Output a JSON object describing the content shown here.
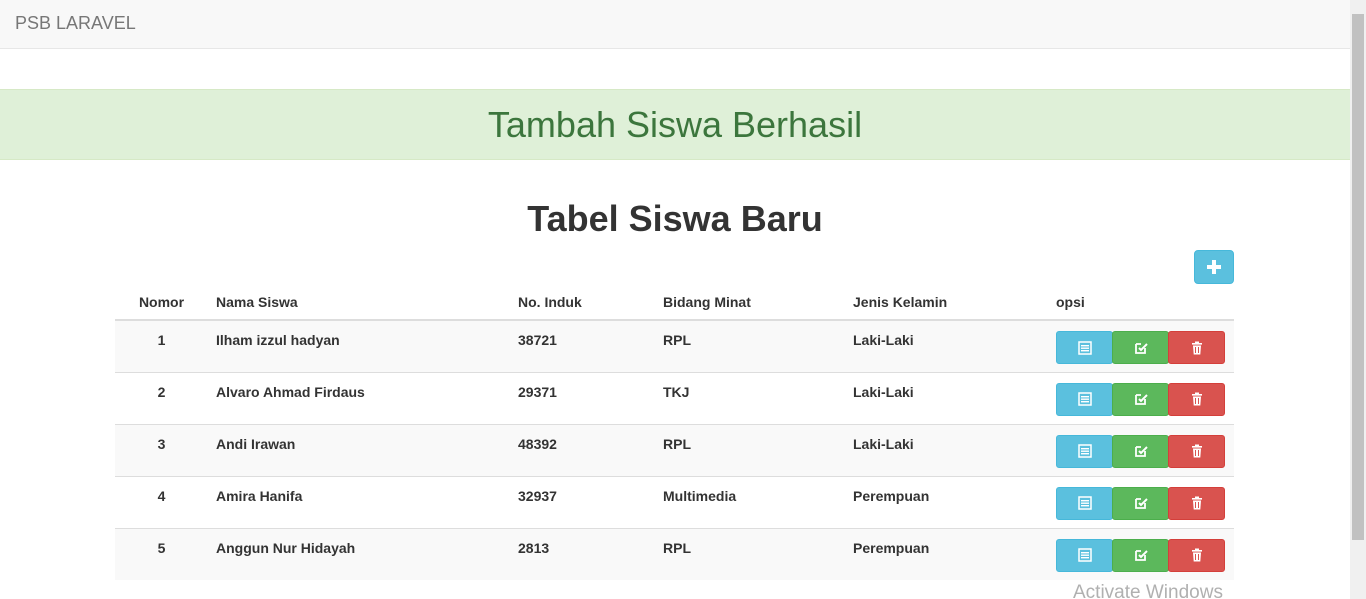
{
  "navbar": {
    "brand": "PSB LARAVEL"
  },
  "alert": {
    "message": "Tambah Siswa Berhasil",
    "color": "#3c763d",
    "background": "#dff0d8"
  },
  "page": {
    "title": "Tabel Siswa Baru"
  },
  "add_button": {
    "icon": "plus-icon"
  },
  "table": {
    "headers": [
      "Nomor",
      "Nama Siswa",
      "No. Induk",
      "Bidang Minat",
      "Jenis Kelamin",
      "opsi"
    ],
    "rows": [
      {
        "no": "1",
        "nama": "Ilham izzul hadyan",
        "induk": "38721",
        "bidang": "RPL",
        "jk": "Laki-Laki"
      },
      {
        "no": "2",
        "nama": "Alvaro Ahmad Firdaus",
        "induk": "29371",
        "bidang": "TKJ",
        "jk": "Laki-Laki"
      },
      {
        "no": "3",
        "nama": "Andi Irawan",
        "induk": "48392",
        "bidang": "RPL",
        "jk": "Laki-Laki"
      },
      {
        "no": "4",
        "nama": "Amira Hanifa",
        "induk": "32937",
        "bidang": "Multimedia",
        "jk": "Perempuan"
      },
      {
        "no": "5",
        "nama": "Anggun Nur Hidayah",
        "induk": "2813",
        "bidang": "RPL",
        "jk": "Perempuan"
      }
    ],
    "actions": [
      {
        "name": "detail-button",
        "icon": "list-icon",
        "color": "#5bc0de"
      },
      {
        "name": "edit-button",
        "icon": "edit-icon",
        "color": "#5cb85c"
      },
      {
        "name": "delete-button",
        "icon": "trash-icon",
        "color": "#d9534f"
      }
    ]
  },
  "watermark": "Activate Windows"
}
